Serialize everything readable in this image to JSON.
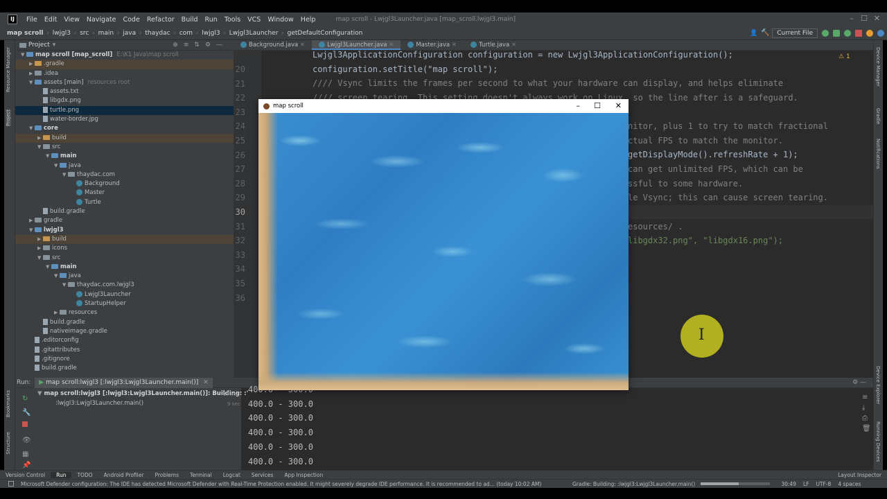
{
  "menubar": {
    "items": [
      "File",
      "Edit",
      "View",
      "Navigate",
      "Code",
      "Refactor",
      "Build",
      "Run",
      "Tools",
      "VCS",
      "Window",
      "Help"
    ],
    "title": "map scroll - Lwjgl3Launcher.java [map_scroll.lwjgl3.main]"
  },
  "breadcrumbs": [
    "map scroll",
    "lwjgl3",
    "src",
    "main",
    "java",
    "thaydac",
    "com",
    "lwjgl3",
    "Lwjgl3Launcher",
    "getDefaultConfiguration"
  ],
  "toolbar": {
    "config": "Current File"
  },
  "project": {
    "header": "Project",
    "tree": [
      {
        "indent": 0,
        "type": "folder-blue",
        "arrow": "▼",
        "label": "map scroll [map_scroll]",
        "extra": "E:\\K1 Java\\map scroll",
        "bold": true
      },
      {
        "indent": 1,
        "type": "folder-orange",
        "arrow": "▶",
        "label": ".gradle",
        "hl": "orange"
      },
      {
        "indent": 1,
        "type": "folder",
        "arrow": "▶",
        "label": ".idea"
      },
      {
        "indent": 1,
        "type": "folder-blue",
        "arrow": "▼",
        "label": "assets [main]",
        "extra": "resources root"
      },
      {
        "indent": 2,
        "type": "file",
        "arrow": "",
        "label": "assets.txt"
      },
      {
        "indent": 2,
        "type": "file",
        "arrow": "",
        "label": "libgdx.png"
      },
      {
        "indent": 2,
        "type": "file",
        "arrow": "",
        "label": "turtle.png",
        "hl": "blue"
      },
      {
        "indent": 2,
        "type": "file",
        "arrow": "",
        "label": "water-border.jpg"
      },
      {
        "indent": 1,
        "type": "folder-blue",
        "arrow": "▼",
        "label": "core",
        "bold": true
      },
      {
        "indent": 2,
        "type": "folder-orange",
        "arrow": "▶",
        "label": "build",
        "hl": "orange"
      },
      {
        "indent": 2,
        "type": "folder",
        "arrow": "▼",
        "label": "src"
      },
      {
        "indent": 3,
        "type": "folder-blue",
        "arrow": "▼",
        "label": "main",
        "bold": true
      },
      {
        "indent": 4,
        "type": "folder-blue",
        "arrow": "▼",
        "label": "java"
      },
      {
        "indent": 5,
        "type": "folder",
        "arrow": "▼",
        "label": "thaydac.com"
      },
      {
        "indent": 6,
        "type": "class",
        "arrow": "",
        "label": "Background"
      },
      {
        "indent": 6,
        "type": "class",
        "arrow": "",
        "label": "Master"
      },
      {
        "indent": 6,
        "type": "class",
        "arrow": "",
        "label": "Turtle"
      },
      {
        "indent": 2,
        "type": "file",
        "arrow": "",
        "label": "build.gradle"
      },
      {
        "indent": 1,
        "type": "folder",
        "arrow": "▶",
        "label": "gradle"
      },
      {
        "indent": 1,
        "type": "folder-blue",
        "arrow": "▼",
        "label": "lwjgl3",
        "bold": true
      },
      {
        "indent": 2,
        "type": "folder-orange",
        "arrow": "▶",
        "label": "build",
        "hl": "orange"
      },
      {
        "indent": 2,
        "type": "folder",
        "arrow": "▶",
        "label": "icons"
      },
      {
        "indent": 2,
        "type": "folder",
        "arrow": "▼",
        "label": "src"
      },
      {
        "indent": 3,
        "type": "folder-blue",
        "arrow": "▼",
        "label": "main",
        "bold": true
      },
      {
        "indent": 4,
        "type": "folder-blue",
        "arrow": "▼",
        "label": "java"
      },
      {
        "indent": 5,
        "type": "folder",
        "arrow": "▼",
        "label": "thaydac.com.lwjgl3"
      },
      {
        "indent": 6,
        "type": "class",
        "arrow": "",
        "label": "Lwjgl3Launcher"
      },
      {
        "indent": 6,
        "type": "class",
        "arrow": "",
        "label": "StartupHelper"
      },
      {
        "indent": 4,
        "type": "folder",
        "arrow": "▶",
        "label": "resources"
      },
      {
        "indent": 2,
        "type": "file",
        "arrow": "",
        "label": "build.gradle"
      },
      {
        "indent": 2,
        "type": "file",
        "arrow": "",
        "label": "nativeimage.gradle"
      },
      {
        "indent": 1,
        "type": "file",
        "arrow": "",
        "label": ".editorconfig"
      },
      {
        "indent": 1,
        "type": "file",
        "arrow": "",
        "label": ".gitattributes"
      },
      {
        "indent": 1,
        "type": "file",
        "arrow": "",
        "label": ".gitignore"
      },
      {
        "indent": 1,
        "type": "file",
        "arrow": "",
        "label": "build.gradle"
      }
    ]
  },
  "editor": {
    "tabs": [
      "Background.java",
      "Lwjgl3Launcher.java",
      "Master.java",
      "Turtle.java"
    ],
    "active_tab": 1,
    "warning_count": "1",
    "line_numbers": [
      "20",
      "21",
      "22",
      "23",
      "24",
      "25",
      "26",
      "27",
      "28",
      "29",
      "30",
      "31",
      "32",
      "33",
      "34",
      "35",
      "36"
    ],
    "lines": {
      "l19": "Lwjgl3ApplicationConfiguration configuration = new Lwjgl3ApplicationConfiguration();",
      "l20": "configuration.setTitle(\"map scroll\");",
      "l21": "//// Vsync limits the frames per second to what your hardware can display, and helps eliminate",
      "l22": "//// screen tearing. This setting doesn't always work on Linux, so the line after is a safeguard.",
      "l24": "nitor, plus 1 to try to match fractional",
      "l25": "ctual FPS to match the monitor.",
      "l26": "getDisplayMode().refreshRate + 1);",
      "l27": "can get unlimited FPS, which can be",
      "l28": "ssful to some hardware.",
      "l29": "le Vsync; this can cause screen tearing.",
      "l31": "esources/ .",
      "l32": "libgdx32.png\", \"libgdx16.png\");"
    }
  },
  "game_window": {
    "title": "map scroll"
  },
  "run": {
    "label": "Run:",
    "tab": "map scroll:lwjgl3 [:lwjgl3:Lwjgl3Launcher.main()]",
    "tree_root": "map scroll:lwjgl3 [:lwjgl3:Lwjgl3Launcher.main()]: Building: :'",
    "tree_root_time": "17 sec",
    "tree_child": ":lwjgl3:Lwjgl3Launcher.main()",
    "tree_child_time": "9 sec",
    "output": [
      "400.0 - 300.0",
      "400.0 - 300.0",
      "400.0 - 300.0",
      "400.0 - 300.0",
      "400.0 - 300.0",
      "400.0 - 300.0"
    ]
  },
  "bottom_tabs": [
    "Version Control",
    "Run",
    "TODO",
    "Android Profiler",
    "Problems",
    "Terminal",
    "Logcat",
    "Services",
    "App Inspection",
    "Layout Inspector"
  ],
  "status": {
    "message": "Microsoft Defender configuration: The IDE has detected Microsoft Defender with Real-Time Protection enabled. It might severely degrade IDE performance. It is recommended to ad... (today 10:02 AM)",
    "build": "Gradle: Building: :lwjgl3:Lwjgl3Launcher.main()",
    "position": "30:49",
    "line_sep": "LF",
    "encoding": "UTF-8",
    "indent": "4 spaces"
  },
  "left_tabs": [
    "Resource Manager",
    "Project",
    "Bookmarks",
    "Structure"
  ],
  "right_tabs": [
    "Device Manager",
    "Gradle",
    "Notifications",
    "Device Explorer",
    "Running Devices"
  ]
}
